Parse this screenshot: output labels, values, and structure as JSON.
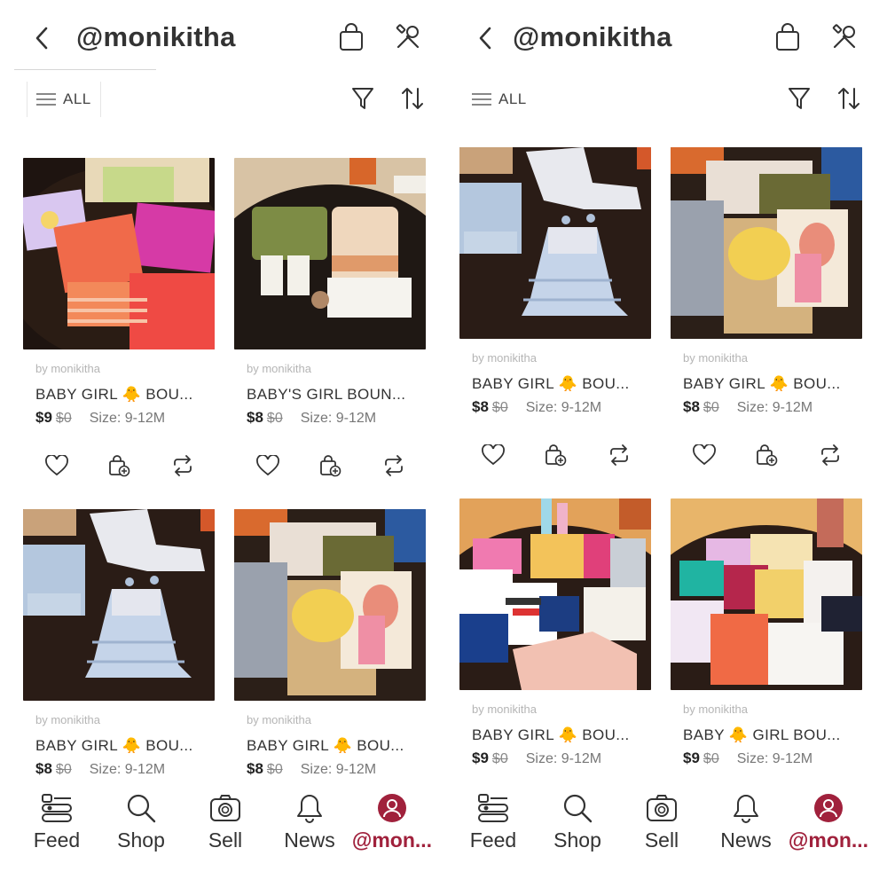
{
  "colors": {
    "accent": "#a0213c",
    "text": "#333333",
    "muted": "#b5b5b5"
  },
  "panels": [
    {
      "header": {
        "title": "@monikitha"
      },
      "filter": {
        "all_label": "ALL"
      },
      "listings": [
        {
          "byline": "by monikitha",
          "title": "BABY GIRL 🐥 BOU...",
          "price": "$9",
          "original_price": "$0",
          "size": "Size: 9-12M"
        },
        {
          "byline": "by monikitha",
          "title": "BABY'S GIRL BOUN...",
          "price": "$8",
          "original_price": "$0",
          "size": "Size: 9-12M"
        },
        {
          "byline": "by monikitha",
          "title": "BABY GIRL 🐥 BOU...",
          "price": "$8",
          "original_price": "$0",
          "size": "Size: 9-12M"
        },
        {
          "byline": "by monikitha",
          "title": "BABY GIRL 🐥 BOU...",
          "price": "$8",
          "original_price": "$0",
          "size": "Size: 9-12M"
        }
      ],
      "tabs": [
        {
          "label": "Feed",
          "icon": "feed-icon"
        },
        {
          "label": "Shop",
          "icon": "search-icon"
        },
        {
          "label": "Sell",
          "icon": "camera-icon"
        },
        {
          "label": "News",
          "icon": "bell-icon"
        },
        {
          "label": "@mon...",
          "icon": "profile-avatar-icon",
          "active": true
        }
      ]
    },
    {
      "header": {
        "title": "@monikitha"
      },
      "filter": {
        "all_label": "ALL"
      },
      "listings": [
        {
          "byline": "by monikitha",
          "title": "BABY GIRL 🐥 BOU...",
          "price": "$8",
          "original_price": "$0",
          "size": "Size: 9-12M"
        },
        {
          "byline": "by monikitha",
          "title": "BABY GIRL 🐥 BOU...",
          "price": "$8",
          "original_price": "$0",
          "size": "Size: 9-12M"
        },
        {
          "byline": "by monikitha",
          "title": "BABY GIRL 🐥 BOU...",
          "price": "$9",
          "original_price": "$0",
          "size": "Size: 9-12M"
        },
        {
          "byline": "by monikitha",
          "title": "BABY 🐥 GIRL BOU...",
          "price": "$9",
          "original_price": "$0",
          "size": "Size: 9-12M"
        }
      ],
      "tabs": [
        {
          "label": "Feed",
          "icon": "feed-icon"
        },
        {
          "label": "Shop",
          "icon": "search-icon"
        },
        {
          "label": "Sell",
          "icon": "camera-icon"
        },
        {
          "label": "News",
          "icon": "bell-icon"
        },
        {
          "label": "@mon...",
          "icon": "profile-avatar-icon",
          "active": true
        }
      ]
    }
  ]
}
